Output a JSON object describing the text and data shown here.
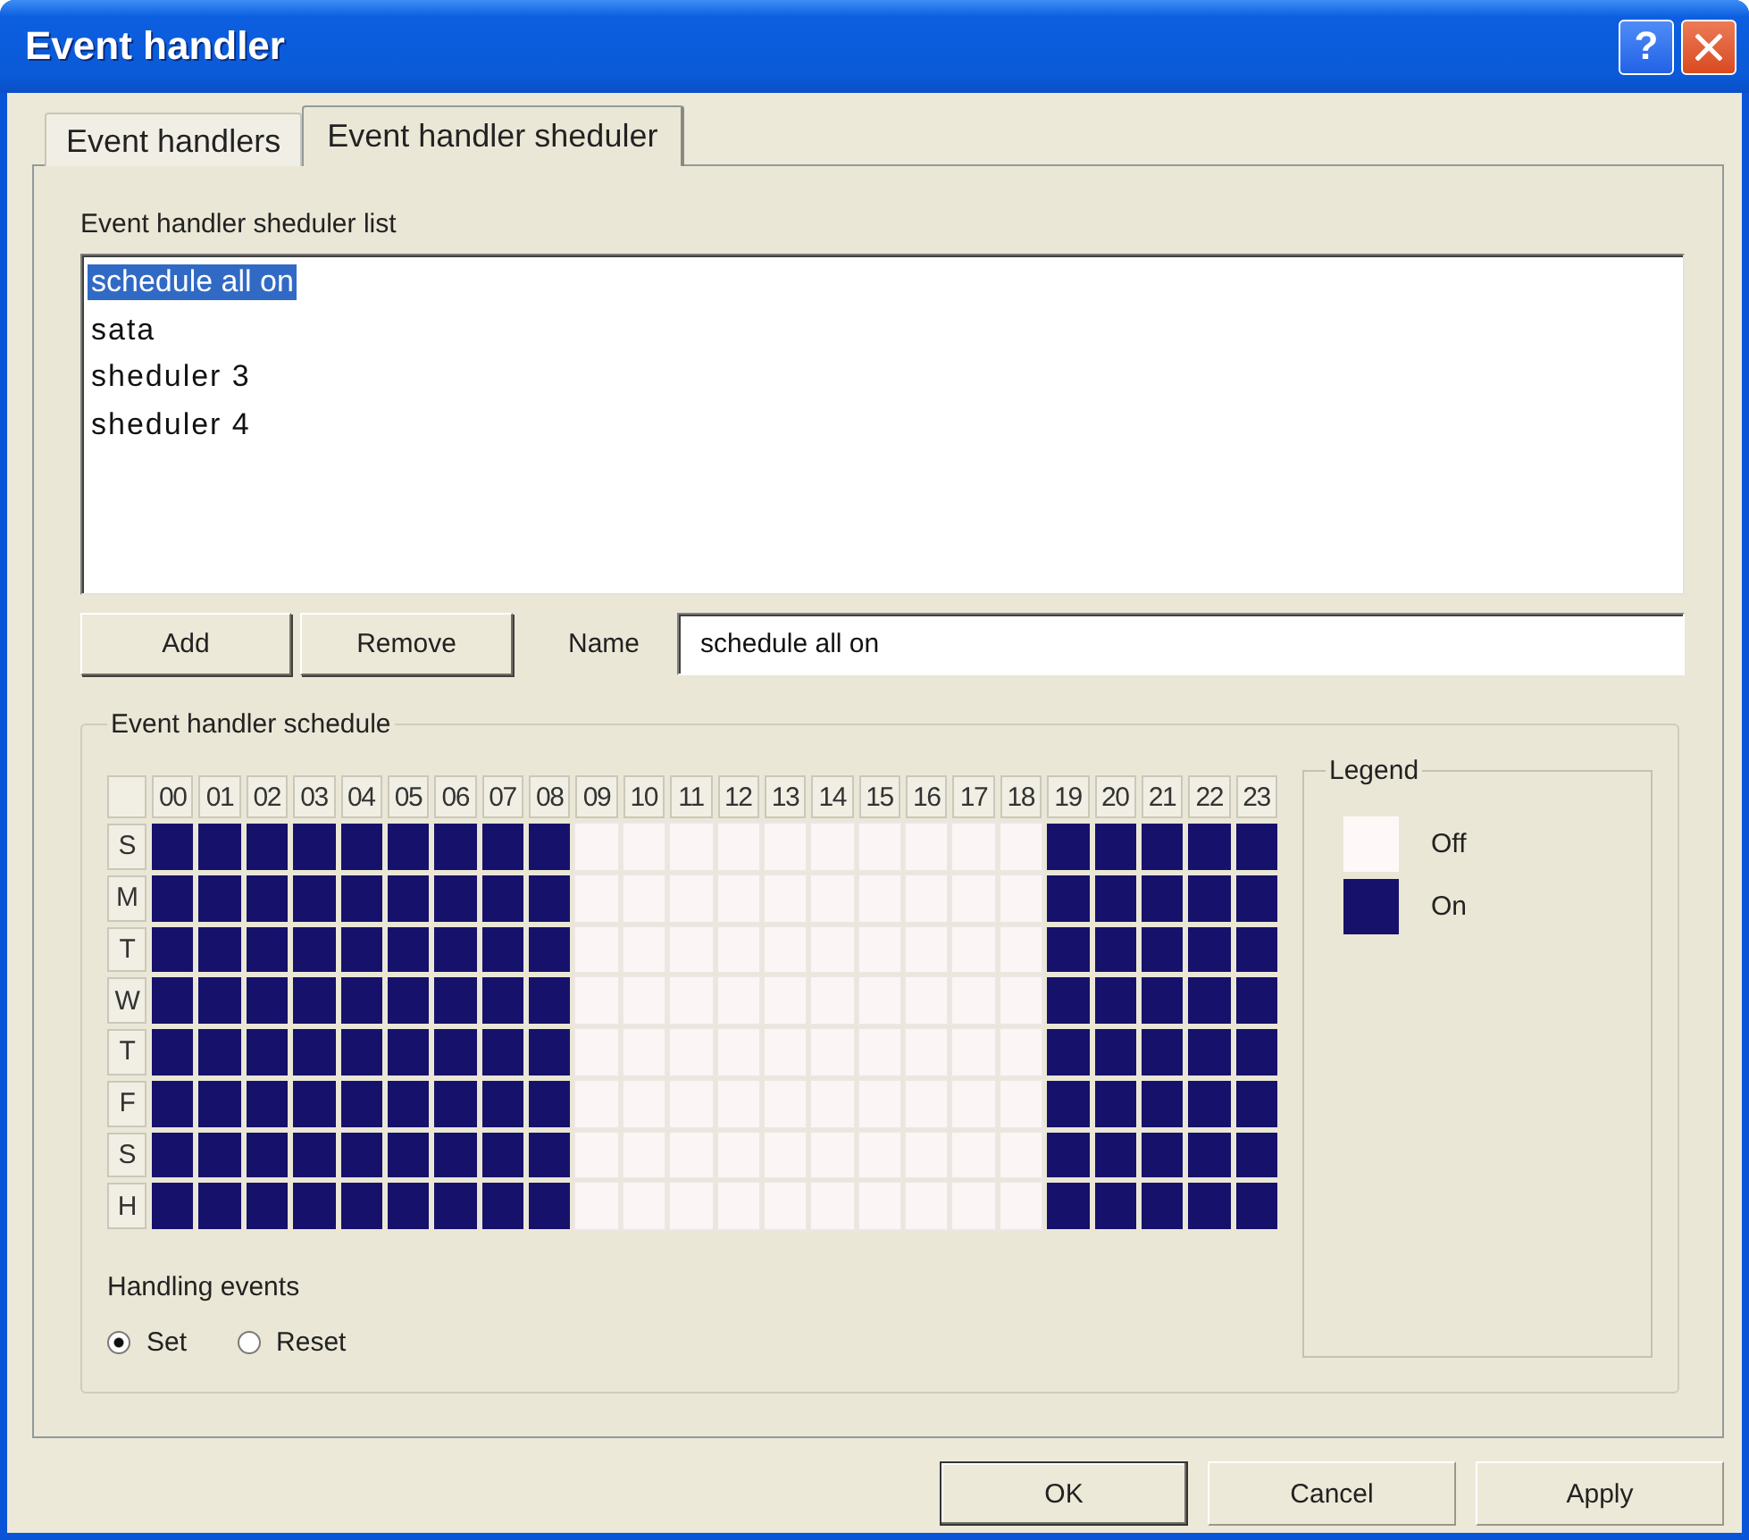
{
  "window": {
    "title": "Event handler",
    "help_button": "?"
  },
  "tabs": [
    {
      "label": "Event handlers",
      "selected": false
    },
    {
      "label": "Event handler sheduler",
      "selected": true
    }
  ],
  "scheduler_list": {
    "label": "Event handler sheduler list",
    "items": [
      {
        "label": "schedule all on",
        "selected": true
      },
      {
        "label": "sata",
        "selected": false
      },
      {
        "label": "sheduler 3",
        "selected": false
      },
      {
        "label": "sheduler 4",
        "selected": false
      }
    ]
  },
  "list_buttons": [
    "Add",
    "Remove"
  ],
  "name_field": {
    "label": "Name",
    "value": "schedule all on"
  },
  "schedule": {
    "title": "Event handler schedule",
    "hours": [
      "00",
      "01",
      "02",
      "03",
      "04",
      "05",
      "06",
      "07",
      "08",
      "09",
      "10",
      "11",
      "12",
      "13",
      "14",
      "15",
      "16",
      "17",
      "18",
      "19",
      "20",
      "21",
      "22",
      "23"
    ],
    "days": [
      {
        "label": "S",
        "cells": [
          true,
          true,
          true,
          true,
          true,
          true,
          true,
          true,
          true,
          false,
          false,
          false,
          false,
          false,
          false,
          false,
          false,
          false,
          false,
          true,
          true,
          true,
          true,
          true
        ]
      },
      {
        "label": "M",
        "cells": [
          true,
          true,
          true,
          true,
          true,
          true,
          true,
          true,
          true,
          false,
          false,
          false,
          false,
          false,
          false,
          false,
          false,
          false,
          false,
          true,
          true,
          true,
          true,
          true
        ]
      },
      {
        "label": "T",
        "cells": [
          true,
          true,
          true,
          true,
          true,
          true,
          true,
          true,
          true,
          false,
          false,
          false,
          false,
          false,
          false,
          false,
          false,
          false,
          false,
          true,
          true,
          true,
          true,
          true
        ]
      },
      {
        "label": "W",
        "cells": [
          true,
          true,
          true,
          true,
          true,
          true,
          true,
          true,
          true,
          false,
          false,
          false,
          false,
          false,
          false,
          false,
          false,
          false,
          false,
          true,
          true,
          true,
          true,
          true
        ]
      },
      {
        "label": "T",
        "cells": [
          true,
          true,
          true,
          true,
          true,
          true,
          true,
          true,
          true,
          false,
          false,
          false,
          false,
          false,
          false,
          false,
          false,
          false,
          false,
          true,
          true,
          true,
          true,
          true
        ]
      },
      {
        "label": "F",
        "cells": [
          true,
          true,
          true,
          true,
          true,
          true,
          true,
          true,
          true,
          false,
          false,
          false,
          false,
          false,
          false,
          false,
          false,
          false,
          false,
          true,
          true,
          true,
          true,
          true
        ]
      },
      {
        "label": "S",
        "cells": [
          true,
          true,
          true,
          true,
          true,
          true,
          true,
          true,
          true,
          false,
          false,
          false,
          false,
          false,
          false,
          false,
          false,
          false,
          false,
          true,
          true,
          true,
          true,
          true
        ]
      },
      {
        "label": "H",
        "cells": [
          true,
          true,
          true,
          true,
          true,
          true,
          true,
          true,
          true,
          false,
          false,
          false,
          false,
          false,
          false,
          false,
          false,
          false,
          false,
          true,
          true,
          true,
          true,
          true
        ]
      }
    ]
  },
  "legend": {
    "title": "Legend",
    "items": [
      {
        "label": "Off",
        "color": "#fff8f8"
      },
      {
        "label": "On",
        "color": "#16116b"
      }
    ]
  },
  "handling_events": {
    "label": "Handling events",
    "options": [
      {
        "label": "Set",
        "selected": true
      },
      {
        "label": "Reset",
        "selected": false
      }
    ]
  },
  "buttons": [
    {
      "label": "OK",
      "default": true
    },
    {
      "label": "Cancel",
      "default": false
    },
    {
      "label": "Apply",
      "default": false
    }
  ]
}
